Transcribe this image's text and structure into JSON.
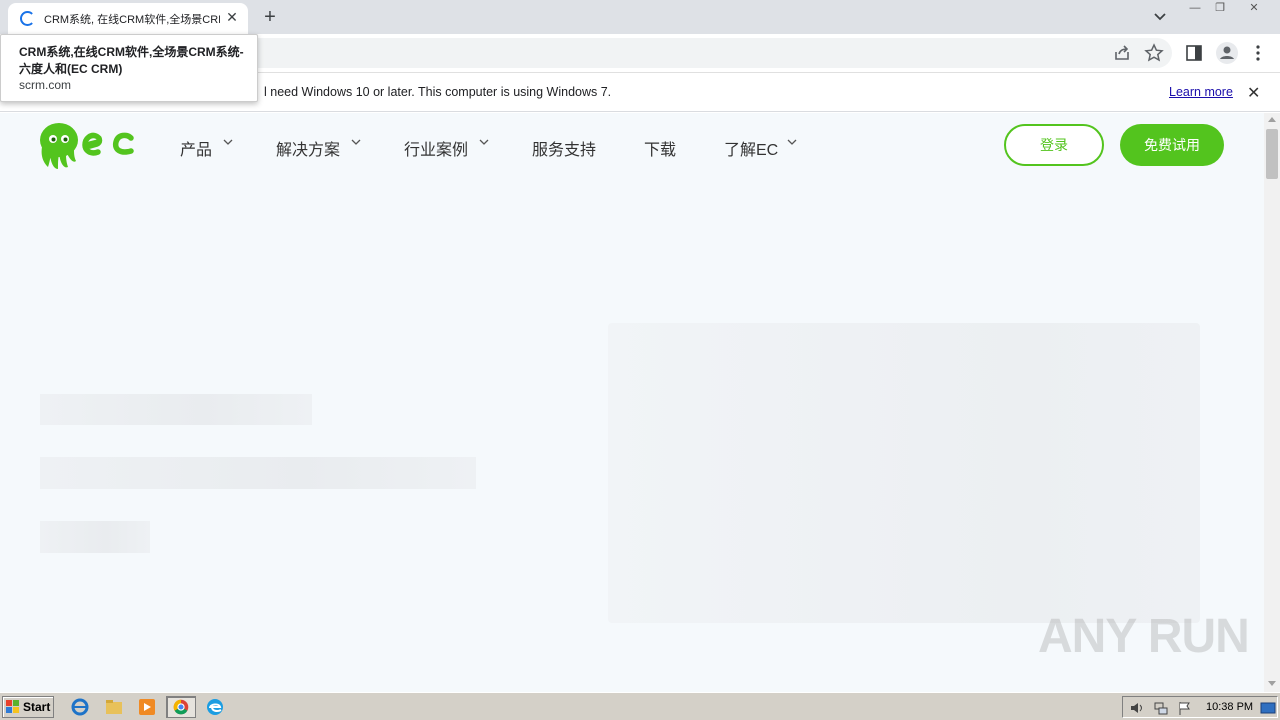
{
  "browser": {
    "tab_title": "CRM系统, 在线CRM软件,全场景CRM系统-六度人和(EC CRM)",
    "new_tab_label": "+",
    "close_tab_label": "✕",
    "window_controls": {
      "minimize": "—",
      "restore": "❐",
      "close": "✕"
    }
  },
  "tooltip": {
    "title": "CRM系统,在线CRM软件,全场景CRM系统-六度人和(EC CRM)",
    "domain": "scrm.com"
  },
  "infobar": {
    "message": "l need Windows 10 or later. This computer is using Windows 7.",
    "learn_more": "Learn more",
    "close": "✕"
  },
  "site": {
    "brand_colors": {
      "primary": "#53c41e",
      "background": "#f5f9fc"
    },
    "nav": [
      {
        "label": "产品",
        "has_dropdown": true
      },
      {
        "label": "解决方案",
        "has_dropdown": true
      },
      {
        "label": "行业案例",
        "has_dropdown": true
      },
      {
        "label": "服务支持",
        "has_dropdown": false
      },
      {
        "label": "下载",
        "has_dropdown": false
      },
      {
        "label": "了解EC",
        "has_dropdown": true
      }
    ],
    "login_label": "登录",
    "trial_label": "免费试用"
  },
  "watermark": "ANY RUN",
  "taskbar": {
    "start_label": "Start",
    "clock": "10:38 PM"
  }
}
